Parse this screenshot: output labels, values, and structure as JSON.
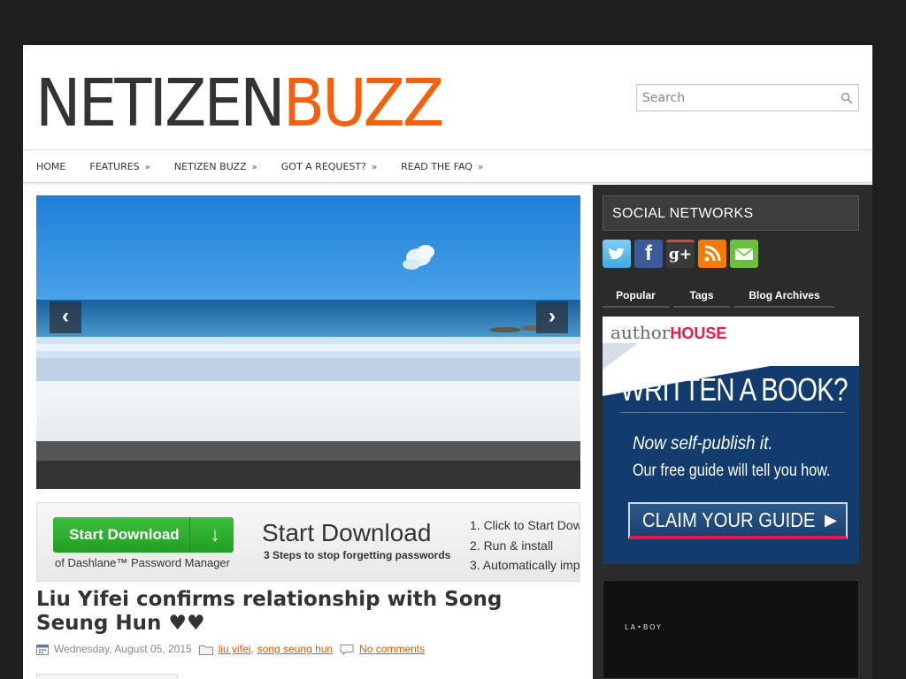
{
  "logo": {
    "part1": "NETIZEN",
    "part2": "BUZZ"
  },
  "search": {
    "placeholder": "Search"
  },
  "nav": {
    "items": [
      {
        "label": "HOME",
        "arrow": ""
      },
      {
        "label": "FEATURES",
        "arrow": "»"
      },
      {
        "label": "NETIZEN BUZZ",
        "arrow": "»"
      },
      {
        "label": "GOT A REQUEST?",
        "arrow": "»"
      },
      {
        "label": "READ THE FAQ",
        "arrow": "»"
      }
    ]
  },
  "slider": {
    "prev": "‹",
    "next": "›"
  },
  "ad": {
    "button": "Start Download",
    "arrow": "↓",
    "sub": "of Dashlane™ Password Manager",
    "title": "Start Download",
    "tagline": "3 Steps to stop forgetting passwords",
    "steps": [
      "1. Click to Start Dow",
      "2. Run & install",
      "3. Automatically imp"
    ]
  },
  "post": {
    "title": "Liu Yifei confirms relationship with Song Seung Hun ♥♥",
    "date": "Wednesday, August 05, 2015",
    "tag1": "liu yifei",
    "sep": ",",
    "tag2": "song seung hun",
    "comments": "No comments"
  },
  "sidebar": {
    "social_title": "SOCIAL NETWORKS",
    "tabs": [
      "Popular",
      "Tags",
      "Blog Archives"
    ],
    "author_ad": {
      "brand1": "author",
      "brand2": "HOUSE",
      "title": "WRITTEN A BOOK?",
      "line1": "Now self-publish it.",
      "line2": "Our free guide will tell you how.",
      "cta": "CLAIM YOUR GUIDE",
      "cta_icon": "▶"
    },
    "lazboy": "LA•BOY"
  },
  "colors": {
    "logo_dark": "#333333",
    "logo_orange": "#f3600f",
    "link": "#e05b00",
    "sidebar_bg": "#2b2b2b"
  }
}
